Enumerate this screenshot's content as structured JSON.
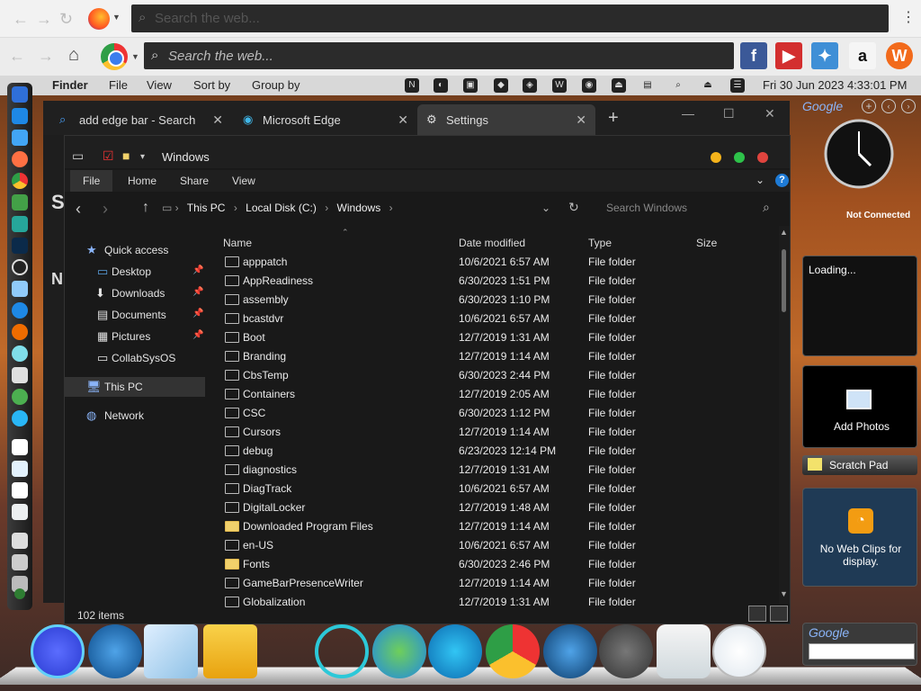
{
  "browser_top": {
    "search_placeholder": "Search the web..."
  },
  "browser_second": {
    "search_placeholder": "Search the web..."
  },
  "finder_menu": {
    "app": "Finder",
    "items": [
      "File",
      "View",
      "Sort by",
      "Group by"
    ],
    "clock": "Fri 30 Jun 2023 4:33:01 PM"
  },
  "edge_tabs": [
    {
      "label": "add edge bar - Search",
      "icon": "search-icon",
      "active": false
    },
    {
      "label": "Microsoft Edge",
      "icon": "edge-icon",
      "active": false
    },
    {
      "label": "Settings",
      "icon": "gear-icon",
      "active": true
    }
  ],
  "settings_peek": {
    "heading_letter": "S",
    "sub_letter": "N"
  },
  "explorer": {
    "title": "Windows",
    "ribbon_tabs": [
      "File",
      "Home",
      "Share",
      "View"
    ],
    "breadcrumb": [
      "This PC",
      "Local Disk (C:)",
      "Windows"
    ],
    "search_placeholder": "Search Windows",
    "nav": [
      {
        "label": "Quick access",
        "icon": "star-icon",
        "pinned": false
      },
      {
        "label": "Desktop",
        "icon": "desktop-icon",
        "pinned": true
      },
      {
        "label": "Downloads",
        "icon": "download-icon",
        "pinned": true
      },
      {
        "label": "Documents",
        "icon": "document-icon",
        "pinned": true
      },
      {
        "label": "Pictures",
        "icon": "pictures-icon",
        "pinned": true
      },
      {
        "label": "CollabSysOS",
        "icon": "folder-icon",
        "pinned": false
      },
      {
        "label": "This PC",
        "icon": "computer-icon",
        "pinned": false
      },
      {
        "label": "Network",
        "icon": "network-icon",
        "pinned": false
      }
    ],
    "columns": {
      "name": "Name",
      "date": "Date modified",
      "type": "Type",
      "size": "Size"
    },
    "files": [
      {
        "name": "apppatch",
        "date": "10/6/2021 6:57 AM",
        "type": "File folder"
      },
      {
        "name": "AppReadiness",
        "date": "6/30/2023 1:51 PM",
        "type": "File folder"
      },
      {
        "name": "assembly",
        "date": "6/30/2023 1:10 PM",
        "type": "File folder"
      },
      {
        "name": "bcastdvr",
        "date": "10/6/2021 6:57 AM",
        "type": "File folder"
      },
      {
        "name": "Boot",
        "date": "12/7/2019 1:31 AM",
        "type": "File folder"
      },
      {
        "name": "Branding",
        "date": "12/7/2019 1:14 AM",
        "type": "File folder"
      },
      {
        "name": "CbsTemp",
        "date": "6/30/2023 2:44 PM",
        "type": "File folder"
      },
      {
        "name": "Containers",
        "date": "12/7/2019 2:05 AM",
        "type": "File folder"
      },
      {
        "name": "CSC",
        "date": "6/30/2023 1:12 PM",
        "type": "File folder"
      },
      {
        "name": "Cursors",
        "date": "12/7/2019 1:14 AM",
        "type": "File folder"
      },
      {
        "name": "debug",
        "date": "6/23/2023 12:14 PM",
        "type": "File folder"
      },
      {
        "name": "diagnostics",
        "date": "12/7/2019 1:31 AM",
        "type": "File folder"
      },
      {
        "name": "DiagTrack",
        "date": "10/6/2021 6:57 AM",
        "type": "File folder"
      },
      {
        "name": "DigitalLocker",
        "date": "12/7/2019 1:48 AM",
        "type": "File folder"
      },
      {
        "name": "Downloaded Program Files",
        "date": "12/7/2019 1:14 AM",
        "type": "File folder"
      },
      {
        "name": "en-US",
        "date": "10/6/2021 6:57 AM",
        "type": "File folder"
      },
      {
        "name": "Fonts",
        "date": "6/30/2023 2:46 PM",
        "type": "File folder"
      },
      {
        "name": "GameBarPresenceWriter",
        "date": "12/7/2019 1:14 AM",
        "type": "File folder"
      },
      {
        "name": "Globalization",
        "date": "12/7/2019 1:31 AM",
        "type": "File folder"
      }
    ],
    "item_count": "102 items"
  },
  "gadgets": {
    "google_label": "Google",
    "not_connected": "Not Connected",
    "loading": "Loading...",
    "add_photos": "Add Photos",
    "scratch_pad": "Scratch Pad",
    "web_clips": "No Web Clips for display.",
    "google_label_2": "Google"
  },
  "colors": {
    "accent": "#1e7bd6",
    "folder": "#f1d16b",
    "dark_bg": "#191919"
  }
}
